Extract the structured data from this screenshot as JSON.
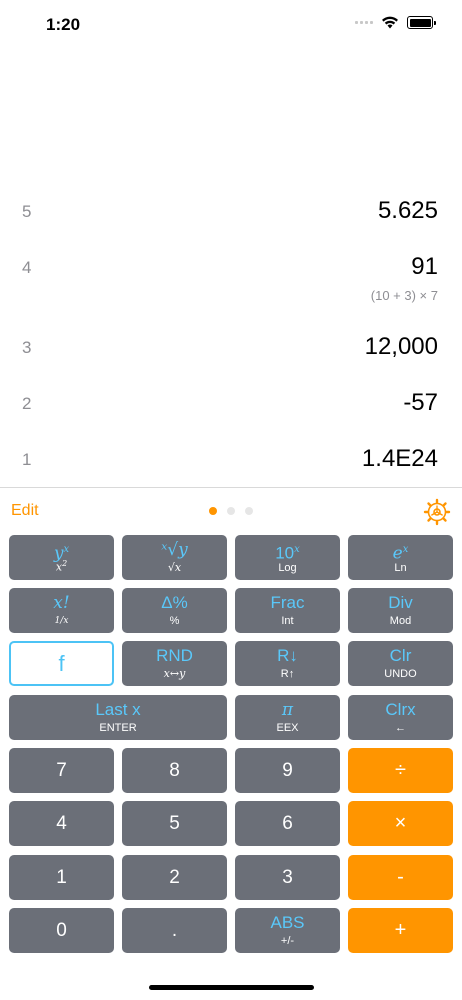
{
  "status": {
    "time": "1:20"
  },
  "stack": [
    {
      "index": "5",
      "value": "5.625",
      "expr": ""
    },
    {
      "index": "4",
      "value": "91",
      "expr": "(10 + 3) × 7"
    },
    {
      "index": "3",
      "value": "12,000",
      "expr": ""
    },
    {
      "index": "2",
      "value": "-57",
      "expr": ""
    },
    {
      "index": "1",
      "value": "1.4E24",
      "expr": ""
    }
  ],
  "toolbar": {
    "edit": "Edit",
    "page_count": 3,
    "active_page": 1
  },
  "colors": {
    "accent": "#ff9500",
    "key": "#6b6f78",
    "shift": "#5ac8fa"
  },
  "keys": {
    "yx": {
      "main_base": "y",
      "main_sup": "x",
      "sub_base": "x",
      "sub_sup": "2"
    },
    "root": {
      "main": "ˣ√y",
      "sub": "√x"
    },
    "ten_x": {
      "main_base": "10",
      "main_sup": "x",
      "sub": "Log"
    },
    "e_x": {
      "main_base": "e",
      "main_sup": "x",
      "sub": "Ln"
    },
    "fact": {
      "main": "x!",
      "sub": "1/x"
    },
    "delta_pct": {
      "main": "Δ%",
      "sub": "%"
    },
    "frac": {
      "main": "Frac",
      "sub": "Int"
    },
    "div_mod": {
      "main": "Div",
      "sub": "Mod"
    },
    "f": {
      "label": "f"
    },
    "rnd": {
      "main": "RND",
      "sub": "x↔y"
    },
    "rdown": {
      "main": "R↓",
      "sub": "R↑"
    },
    "clr": {
      "main": "Clr",
      "sub": "UNDO"
    },
    "enter": {
      "main": "Last x",
      "sub": "ENTER"
    },
    "pi": {
      "main": "π",
      "sub": "EEX"
    },
    "clrx": {
      "main": "Clrx",
      "sub": "←"
    },
    "d7": "7",
    "d8": "8",
    "d9": "9",
    "divide": "÷",
    "d4": "4",
    "d5": "5",
    "d6": "6",
    "multiply": "×",
    "d1": "1",
    "d2": "2",
    "d3": "3",
    "minus": "-",
    "d0": "0",
    "dot": ".",
    "abs": {
      "main": "ABS",
      "sub": "+/-"
    },
    "plus": "+"
  }
}
